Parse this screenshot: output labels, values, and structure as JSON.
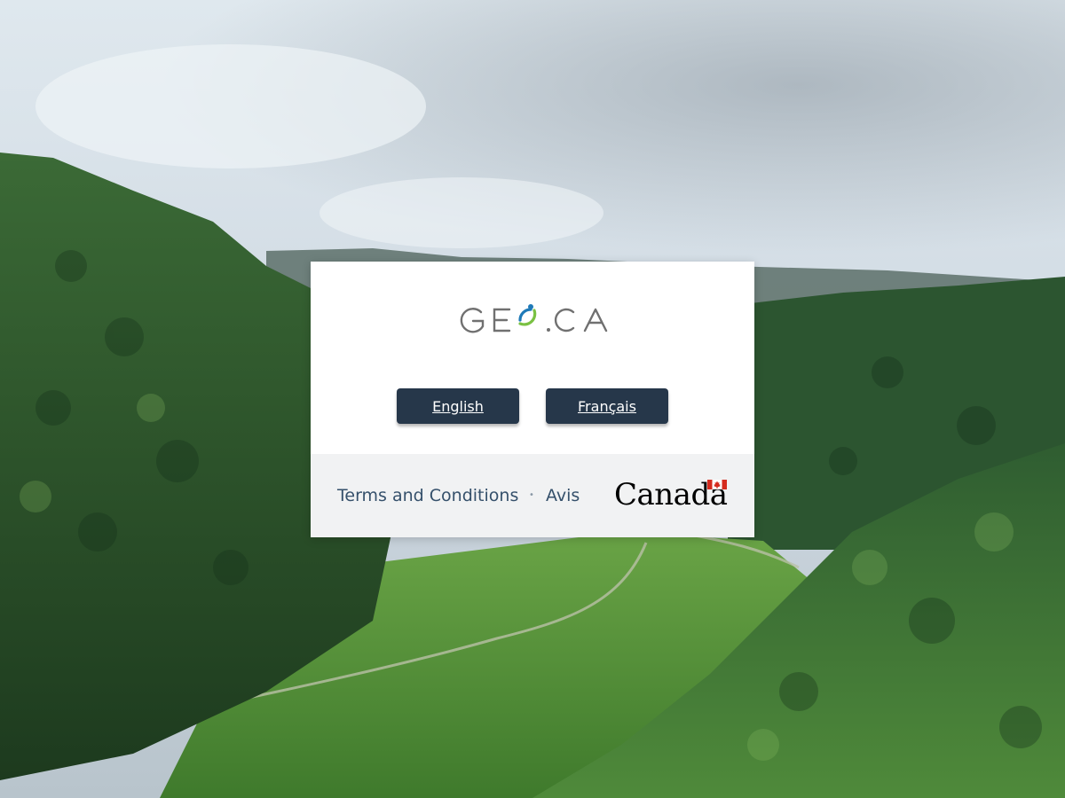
{
  "background": {
    "description_icon": "forest-valley-image",
    "sky_color": "#c9d6e0",
    "forest_color": "#2f5a2e",
    "meadow_color": "#5f9a3c"
  },
  "card": {
    "logo_text": "GEO.CA",
    "buttons": {
      "english_label": "English",
      "french_label": "Français"
    },
    "footer": {
      "terms_label": "Terms and Conditions",
      "separator": "•",
      "avis_label": "Avis",
      "wordmark_text": "Canada"
    }
  },
  "colors": {
    "button_bg": "#26374a",
    "link_color": "#35506b",
    "footer_bg": "#f1f2f3",
    "logo_gray": "#707070",
    "logo_blue": "#1f7ab8",
    "logo_green": "#7ac143",
    "flag_red": "#d52b1e"
  }
}
